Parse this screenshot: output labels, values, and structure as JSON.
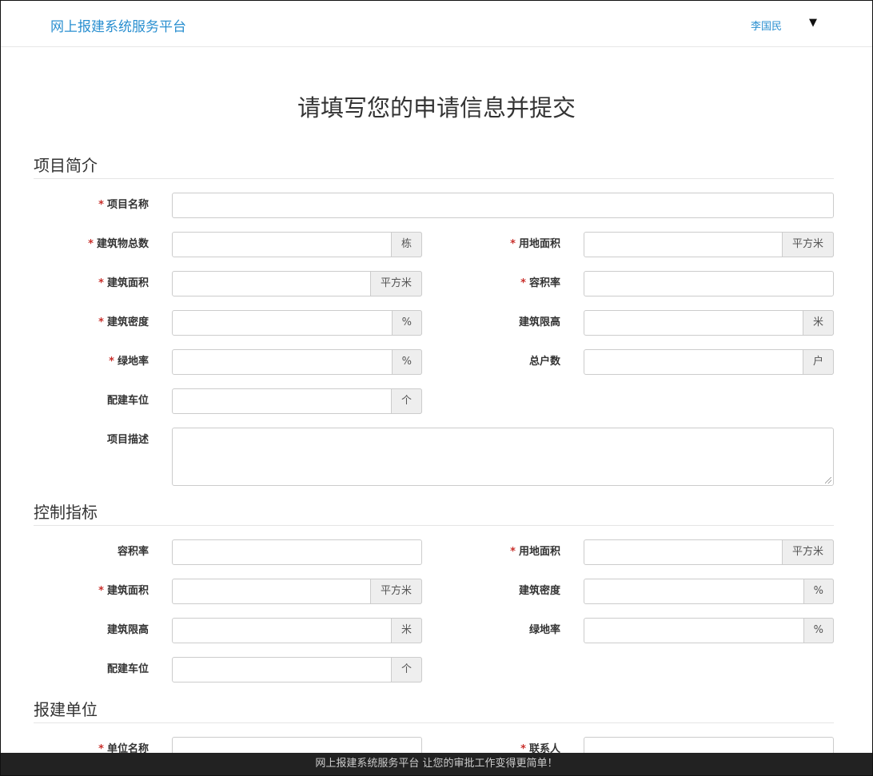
{
  "header": {
    "brand": "网上报建系统服务平台",
    "user": "李国民",
    "caret": "▼"
  },
  "page_title": "请填写您的申请信息并提交",
  "sections": {
    "intro": "项目简介",
    "control": "控制指标",
    "unit": "报建单位"
  },
  "intro": {
    "project_name": "项目名称",
    "building_count": "建筑物总数",
    "building_count_unit": "栋",
    "land_area": "用地面积",
    "land_area_unit": "平方米",
    "floor_area": "建筑面积",
    "floor_area_unit": "平方米",
    "plot_ratio": "容积率",
    "density": "建筑密度",
    "density_unit": "%",
    "height_limit": "建筑限高",
    "height_limit_unit": "米",
    "green_rate": "绿地率",
    "green_rate_unit": "%",
    "households": "总户数",
    "households_unit": "户",
    "parking": "配建车位",
    "parking_unit": "个",
    "description": "项目描述"
  },
  "control": {
    "plot_ratio": "容积率",
    "land_area": "用地面积",
    "land_area_unit": "平方米",
    "floor_area": "建筑面积",
    "floor_area_unit": "平方米",
    "density": "建筑密度",
    "density_unit": "%",
    "height_limit": "建筑限高",
    "height_limit_unit": "米",
    "green_rate": "绿地率",
    "green_rate_unit": "%",
    "parking": "配建车位",
    "parking_unit": "个"
  },
  "unit": {
    "unit_name": "单位名称",
    "contact": "联系人"
  },
  "required_mark": "*",
  "footer": "网上报建系统服务平台 让您的审批工作变得更简单！"
}
